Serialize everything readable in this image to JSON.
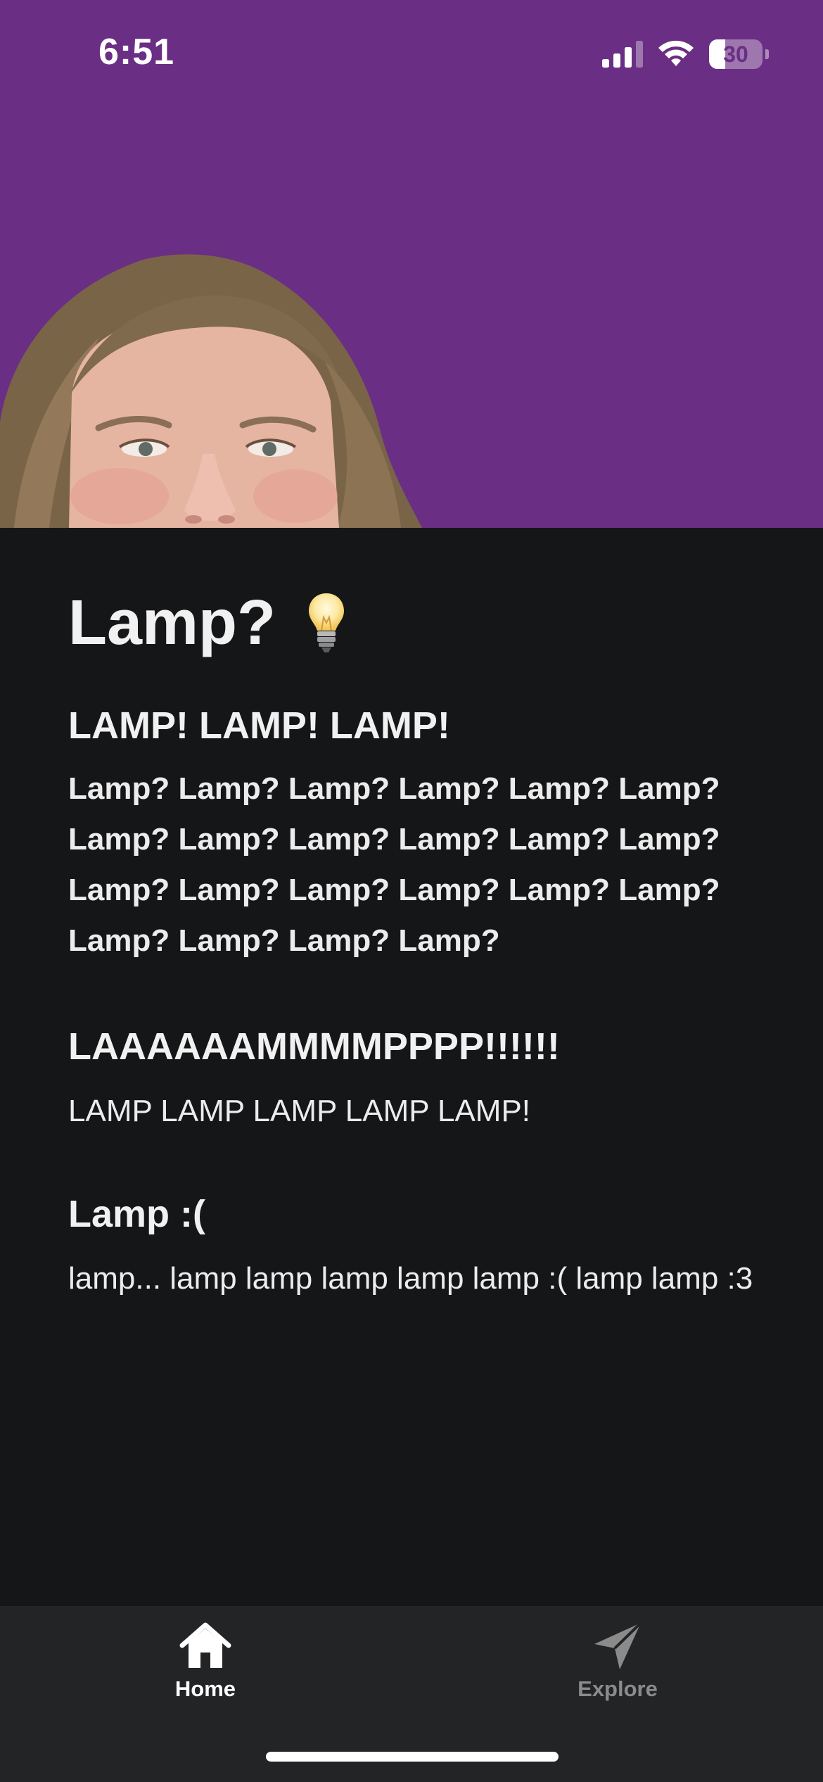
{
  "status_bar": {
    "time": "6:51",
    "signal_bars_active": 3,
    "signal_bars_total": 4,
    "battery_percent": "30"
  },
  "header": {
    "background_color": "#6a2f84"
  },
  "content": {
    "title": "Lamp?",
    "sections": [
      {
        "heading": "LAMP! LAMP! LAMP!",
        "body": "Lamp? Lamp? Lamp? Lamp? Lamp? Lamp? Lamp? Lamp? Lamp? Lamp? Lamp? Lamp? Lamp? Lamp? Lamp? Lamp? Lamp? Lamp? Lamp? Lamp? Lamp? Lamp?"
      },
      {
        "heading": "LAAAAAAMMMMPPPP!!!!!!",
        "body": "LAMP LAMP LAMP LAMP LAMP!"
      },
      {
        "heading": "Lamp :(",
        "body": "lamp... lamp lamp lamp lamp lamp :( lamp lamp :3"
      }
    ]
  },
  "tab_bar": {
    "tabs": [
      {
        "label": "Home",
        "icon": "home-icon",
        "active": true
      },
      {
        "label": "Explore",
        "icon": "paper-plane-icon",
        "active": false
      }
    ],
    "active_color": "#ffffff",
    "inactive_color": "#8b8b8b",
    "background_color": "#232425"
  }
}
